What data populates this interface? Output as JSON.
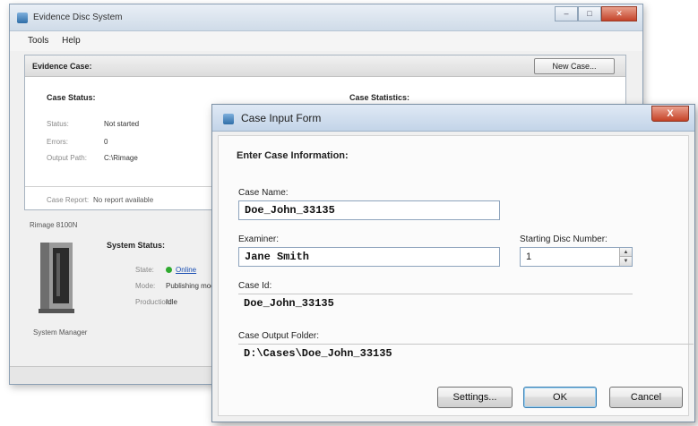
{
  "back_window": {
    "title": "Evidence Disc System",
    "menu": [
      "Tools",
      "Help"
    ],
    "case_panel": {
      "header": "Evidence Case:",
      "new_case_button": "New Case...",
      "case_status_title": "Case Status:",
      "case_statistics_title": "Case Statistics:",
      "status_label": "Status:",
      "status_value": "Not started",
      "errors_label": "Errors:",
      "errors_value": "0",
      "output_path_label": "Output Path:",
      "output_path_value": "C:\\Rimage",
      "case_report_label": "Case Report:",
      "case_report_value": "No report available"
    },
    "device": {
      "name": "Rimage 8100N",
      "system_status_title": "System Status:",
      "state_label": "State:",
      "state_value": "Online",
      "mode_label": "Mode:",
      "mode_value": "Publishing mod",
      "production_label": "Production:",
      "production_value": "Idle",
      "system_manager": "System Manager"
    }
  },
  "dialog": {
    "title": "Case Input Form",
    "close_glyph": "X",
    "heading": "Enter Case Information:",
    "case_name_label": "Case Name:",
    "case_name_value": "Doe_John_33135",
    "examiner_label": "Examiner:",
    "examiner_value": "Jane Smith",
    "starting_disc_label": "Starting Disc Number:",
    "starting_disc_value": "1",
    "case_id_label": "Case Id:",
    "case_id_value": "Doe_John_33135",
    "case_output_label": "Case Output Folder:",
    "case_output_value": "D:\\Cases\\Doe_John_33135",
    "settings_button": "Settings...",
    "ok_button": "OK",
    "cancel_button": "Cancel"
  }
}
